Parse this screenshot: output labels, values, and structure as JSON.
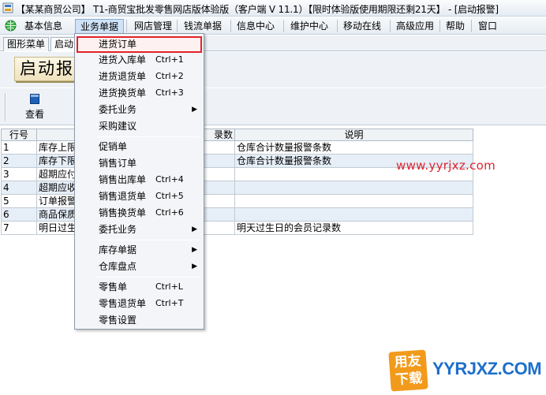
{
  "window": {
    "title": "【某某商贸公司】 T1-商贸宝批发零售网店版体验版（客户端 V 11.1）【限时体验版使用期限还剩21天】 - [启动报警]"
  },
  "menubar": {
    "items": [
      {
        "label": "基本信息"
      },
      {
        "label": "业务单据"
      },
      {
        "label": "网店管理"
      },
      {
        "label": "钱流单据"
      },
      {
        "label": "信息中心"
      },
      {
        "label": "维护中心"
      },
      {
        "label": "移动在线"
      },
      {
        "label": "高级应用"
      },
      {
        "label": "帮助"
      },
      {
        "label": "窗口"
      }
    ]
  },
  "tabs": [
    {
      "label": "图形菜单"
    },
    {
      "label": "启动"
    }
  ],
  "banner": {
    "caption": "启动报"
  },
  "toolbar": {
    "view_label": "查看"
  },
  "grid": {
    "headers": {
      "row_no": "行号",
      "name": "",
      "count": "录数",
      "desc": "说明"
    },
    "rows": [
      {
        "no": "1",
        "name": "库存上限",
        "desc": "仓库合计数量报警条数"
      },
      {
        "no": "2",
        "name": "库存下限",
        "desc": "仓库合计数量报警条数"
      },
      {
        "no": "3",
        "name": "超期应付",
        "desc": ""
      },
      {
        "no": "4",
        "name": "超期应收",
        "desc": ""
      },
      {
        "no": "5",
        "name": "订单报警",
        "desc": ""
      },
      {
        "no": "6",
        "name": "商品保质",
        "desc": ""
      },
      {
        "no": "7",
        "name": "明日过生",
        "desc": "明天过生日的会员记录数"
      }
    ]
  },
  "dropdown": {
    "items": [
      {
        "label": "进货订单",
        "shortcut": "",
        "submenu": false,
        "highlighted": true
      },
      {
        "label": "进货入库单",
        "shortcut": "Ctrl+1",
        "submenu": false
      },
      {
        "label": "进货退货单",
        "shortcut": "Ctrl+2",
        "submenu": false
      },
      {
        "label": "进货换货单",
        "shortcut": "Ctrl+3",
        "submenu": false
      },
      {
        "label": "委托业务",
        "shortcut": "",
        "submenu": true
      },
      {
        "label": "采购建议",
        "shortcut": "",
        "submenu": false
      },
      {
        "label": "促销单",
        "shortcut": "",
        "submenu": false
      },
      {
        "label": "销售订单",
        "shortcut": "",
        "submenu": false
      },
      {
        "label": "销售出库单",
        "shortcut": "Ctrl+4",
        "submenu": false
      },
      {
        "label": "销售退货单",
        "shortcut": "Ctrl+5",
        "submenu": false
      },
      {
        "label": "销售换货单",
        "shortcut": "Ctrl+6",
        "submenu": false
      },
      {
        "label": "委托业务",
        "shortcut": "",
        "submenu": true
      },
      {
        "label": "库存单据",
        "shortcut": "",
        "submenu": true
      },
      {
        "label": "仓库盘点",
        "shortcut": "",
        "submenu": true
      },
      {
        "label": "零售单",
        "shortcut": "Ctrl+L",
        "submenu": false
      },
      {
        "label": "零售退货单",
        "shortcut": "Ctrl+T",
        "submenu": false
      },
      {
        "label": "零售设置",
        "shortcut": "",
        "submenu": false
      }
    ],
    "arrow_glyph": "▶"
  },
  "watermark": {
    "text": "www.yyrjxz.com"
  },
  "logo": {
    "badge_top": "用友",
    "badge_bottom": "下载",
    "site": "YYRJXZ.COM"
  },
  "colors": {
    "highlight_border": "#e2232a",
    "watermark": "#e0252c",
    "logo_badge": "#f29a1b",
    "logo_text": "#1d6fc9"
  }
}
